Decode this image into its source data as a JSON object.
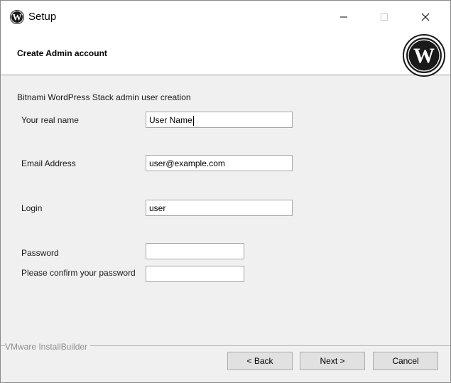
{
  "window": {
    "title": "Setup",
    "icon": "wordpress-logo-icon",
    "controls": [
      "minimize-icon",
      "maximize-icon",
      "close-icon"
    ]
  },
  "header": {
    "title": "Create Admin account",
    "logo": "wordpress-logo-icon"
  },
  "form": {
    "subtitle": "Bitnami WordPress Stack admin user creation",
    "real_name_label": "Your real name",
    "real_name_value": "User Name",
    "email_label": "Email Address",
    "email_value": "user@example.com",
    "login_label": "Login",
    "login_value": "user",
    "password_label": "Password",
    "password_value": "",
    "confirm_label": "Please confirm your password",
    "confirm_value": ""
  },
  "footer": {
    "brand": "VMware InstallBuilder",
    "back_label": "< Back",
    "next_label": "Next >",
    "cancel_label": "Cancel"
  }
}
